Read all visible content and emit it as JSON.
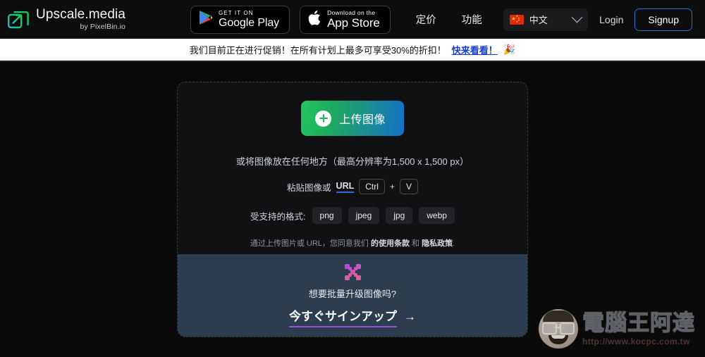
{
  "header": {
    "brand": {
      "logo_icon": "upscale-arrow-icon",
      "title_main": "Upscale",
      "title_accent": ".media",
      "subtitle": "by PixelBin.io"
    },
    "store_badges": [
      {
        "icon": "google-play-icon",
        "small_label": "GET IT ON",
        "big_label": "Google Play"
      },
      {
        "icon": "apple-logo-icon",
        "small_label": "Download on the",
        "big_label": "App Store"
      }
    ],
    "nav_links": [
      {
        "label": "定价"
      },
      {
        "label": "功能"
      }
    ],
    "language": {
      "flag_icon": "china-flag-icon",
      "label": "中文",
      "chevron_icon": "chevron-down-icon"
    },
    "auth": {
      "login_label": "Login",
      "signup_label": "Signup",
      "signup_border_color": "#2f6fdb"
    }
  },
  "promo": {
    "message": "我们目前正在进行促销！在所有计划上最多可享受30%的折扣！",
    "cta_label": "快来看看！",
    "cta_color": "#1a3fcf",
    "emoji": "🎉"
  },
  "dropzone": {
    "upload_button": {
      "label": "上传图像",
      "icon": "plus-circle-icon",
      "gradient_from": "#22c55e",
      "gradient_to": "#1570c9"
    },
    "drop_hint": "或将图像放在任何地方（最高分辨率为1,500 x 1,500 px）",
    "paste": {
      "prefix": "粘贴图像或",
      "url_label": "URL",
      "key_ctrl": "Ctrl",
      "key_plus": "+",
      "key_v": "V"
    },
    "formats": {
      "label": "受支持的格式:",
      "items": [
        "png",
        "jpeg",
        "jpg",
        "webp"
      ]
    },
    "terms": {
      "prefix": "通过上传图片或 URL，您同意我们",
      "terms_link": "的使用条款",
      "conjunction": "和",
      "privacy_link": "隐私政策",
      "suffix": "."
    }
  },
  "batch_banner": {
    "icon": "pixelbin-x-icon",
    "icon_color_from": "#b548e8",
    "icon_color_to": "#e0609a",
    "question": "想要批量升级图像吗?",
    "cta_label": "今すぐサインアップ",
    "cta_arrow": "→",
    "underline_color": "#9b4fd6",
    "background": "#2c3d4f"
  },
  "watermark": {
    "face_icon": "cartoon-face-icon",
    "site_name": "電腦王阿達",
    "url": "http://www.kocpc.com.tw"
  }
}
